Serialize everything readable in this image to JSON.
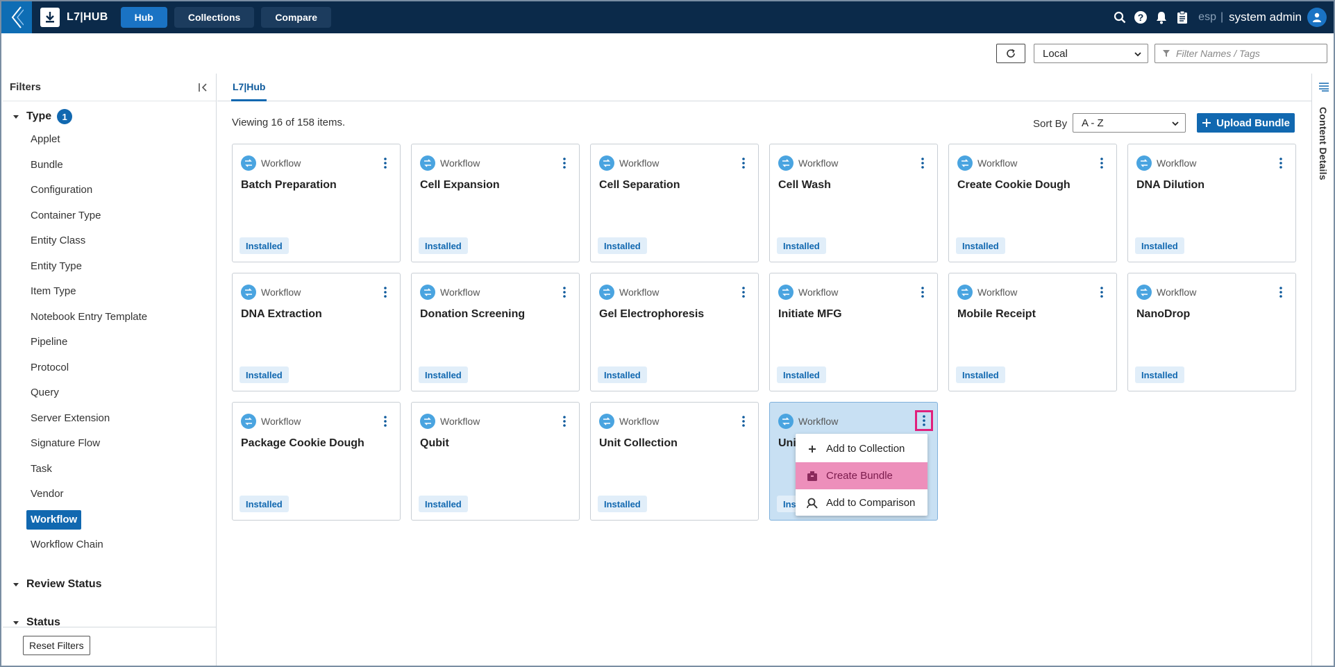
{
  "topbar": {
    "app_title": "L7|HUB",
    "nav": [
      {
        "label": "Hub",
        "active": true
      },
      {
        "label": "Collections",
        "active": false
      },
      {
        "label": "Compare",
        "active": false
      }
    ],
    "language": "esp",
    "separator": "|",
    "user_name": "system admin",
    "icons": [
      "back-icon",
      "download-icon",
      "search-icon",
      "help-icon",
      "bell-icon",
      "clipboard-icon",
      "user-avatar-icon"
    ]
  },
  "toolbar": {
    "source_value": "Local",
    "filter_placeholder": "Filter Names / Tags"
  },
  "filters": {
    "title": "Filters",
    "type_group": {
      "label": "Type",
      "count": "1",
      "items": [
        {
          "label": "Applet"
        },
        {
          "label": "Bundle"
        },
        {
          "label": "Configuration"
        },
        {
          "label": "Container Type"
        },
        {
          "label": "Entity Class"
        },
        {
          "label": "Entity Type"
        },
        {
          "label": "Item Type"
        },
        {
          "label": "Notebook Entry Template"
        },
        {
          "label": "Pipeline"
        },
        {
          "label": "Protocol"
        },
        {
          "label": "Query"
        },
        {
          "label": "Server Extension"
        },
        {
          "label": "Signature Flow"
        },
        {
          "label": "Task"
        },
        {
          "label": "Vendor"
        },
        {
          "label": "Workflow",
          "selected": true
        },
        {
          "label": "Workflow Chain"
        }
      ]
    },
    "review_status_label": "Review Status",
    "status_label": "Status",
    "reset_label": "Reset Filters"
  },
  "main": {
    "tab_label": "L7|Hub",
    "viewing_text": "Viewing 16 of 158 items.",
    "sort_label": "Sort By",
    "sort_value": "A - Z",
    "upload_label": "Upload Bundle",
    "cards": [
      {
        "type": "Workflow",
        "title": "Batch Preparation",
        "status": "Installed"
      },
      {
        "type": "Workflow",
        "title": "Cell Expansion",
        "status": "Installed"
      },
      {
        "type": "Workflow",
        "title": "Cell Separation",
        "status": "Installed"
      },
      {
        "type": "Workflow",
        "title": "Cell Wash",
        "status": "Installed"
      },
      {
        "type": "Workflow",
        "title": "Create Cookie Dough",
        "status": "Installed"
      },
      {
        "type": "Workflow",
        "title": "DNA Dilution",
        "status": "Installed"
      },
      {
        "type": "Workflow",
        "title": "DNA Extraction",
        "status": "Installed"
      },
      {
        "type": "Workflow",
        "title": "Donation Screening",
        "status": "Installed"
      },
      {
        "type": "Workflow",
        "title": "Gel Electrophoresis",
        "status": "Installed"
      },
      {
        "type": "Workflow",
        "title": "Initiate MFG",
        "status": "Installed"
      },
      {
        "type": "Workflow",
        "title": "Mobile Receipt",
        "status": "Installed"
      },
      {
        "type": "Workflow",
        "title": "NanoDrop",
        "status": "Installed"
      },
      {
        "type": "Workflow",
        "title": "Package Cookie Dough",
        "status": "Installed"
      },
      {
        "type": "Workflow",
        "title": "Qubit",
        "status": "Installed"
      },
      {
        "type": "Workflow",
        "title": "Unit Collection",
        "status": "Installed"
      },
      {
        "type": "Workflow",
        "title": "Uni",
        "status": "Ins",
        "selected": true
      }
    ],
    "context_menu": [
      {
        "label": "Add to Collection",
        "icon": "plus-icon"
      },
      {
        "label": "Create Bundle",
        "icon": "bundle-icon",
        "hover": true
      },
      {
        "label": "Add to Comparison",
        "icon": "compare-icon"
      }
    ]
  },
  "right_rail": {
    "label": "Content Details"
  },
  "colors": {
    "topbar_bg": "#0b2a4a",
    "accent": "#1168b0",
    "card_selected_bg": "#c8e0f3",
    "menu_hover": "#ed8fbb",
    "highlight_border": "#e0207c"
  }
}
